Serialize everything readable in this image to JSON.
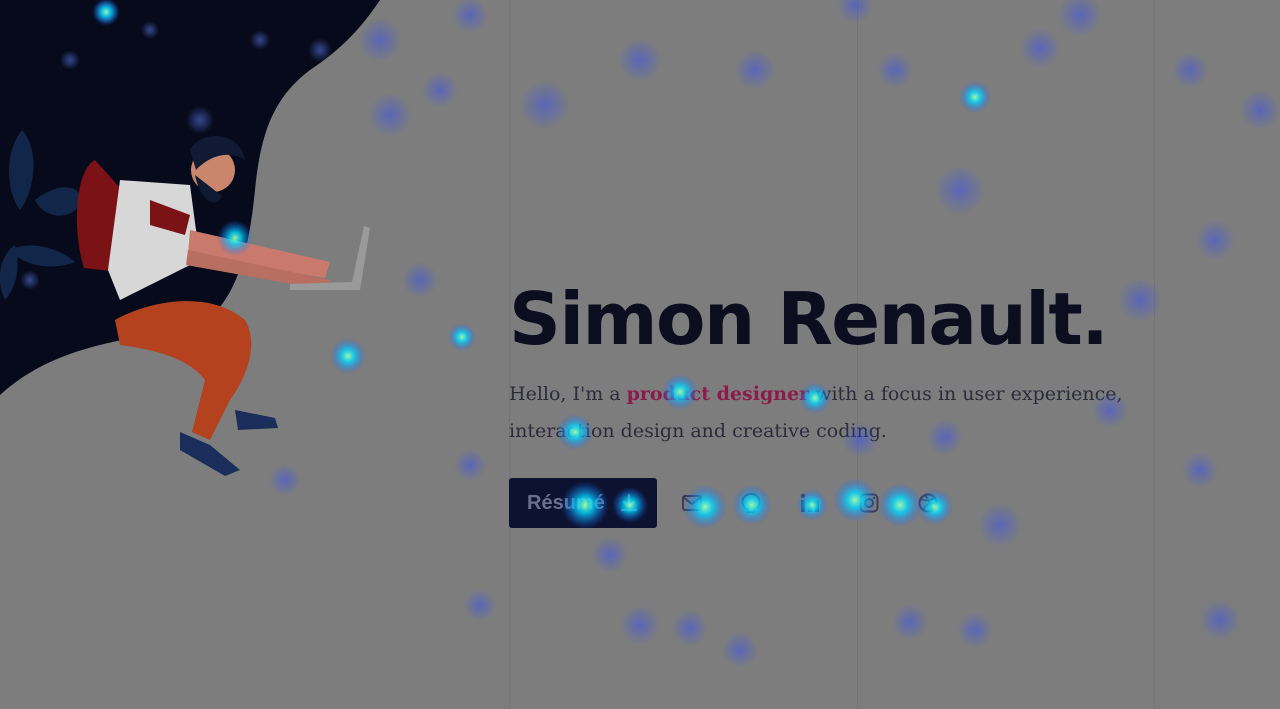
{
  "hero": {
    "title": "Simon Renault.",
    "intro_before": "Hello, I'm a ",
    "intro_highlight": "product designer",
    "intro_after": " with a focus in user experience, interaction design and creative coding."
  },
  "actions": {
    "resume_label": "Résumé"
  },
  "social": [
    {
      "icon": "mail-icon"
    },
    {
      "icon": "github-icon"
    },
    {
      "icon": "linkedin-icon"
    },
    {
      "icon": "instagram-icon"
    },
    {
      "icon": "dribbble-icon"
    }
  ],
  "colors": {
    "title": "#0c0d1f",
    "highlight": "#8c1b4c",
    "button_bg": "#0d1230",
    "night_sky": "#060a1a"
  }
}
